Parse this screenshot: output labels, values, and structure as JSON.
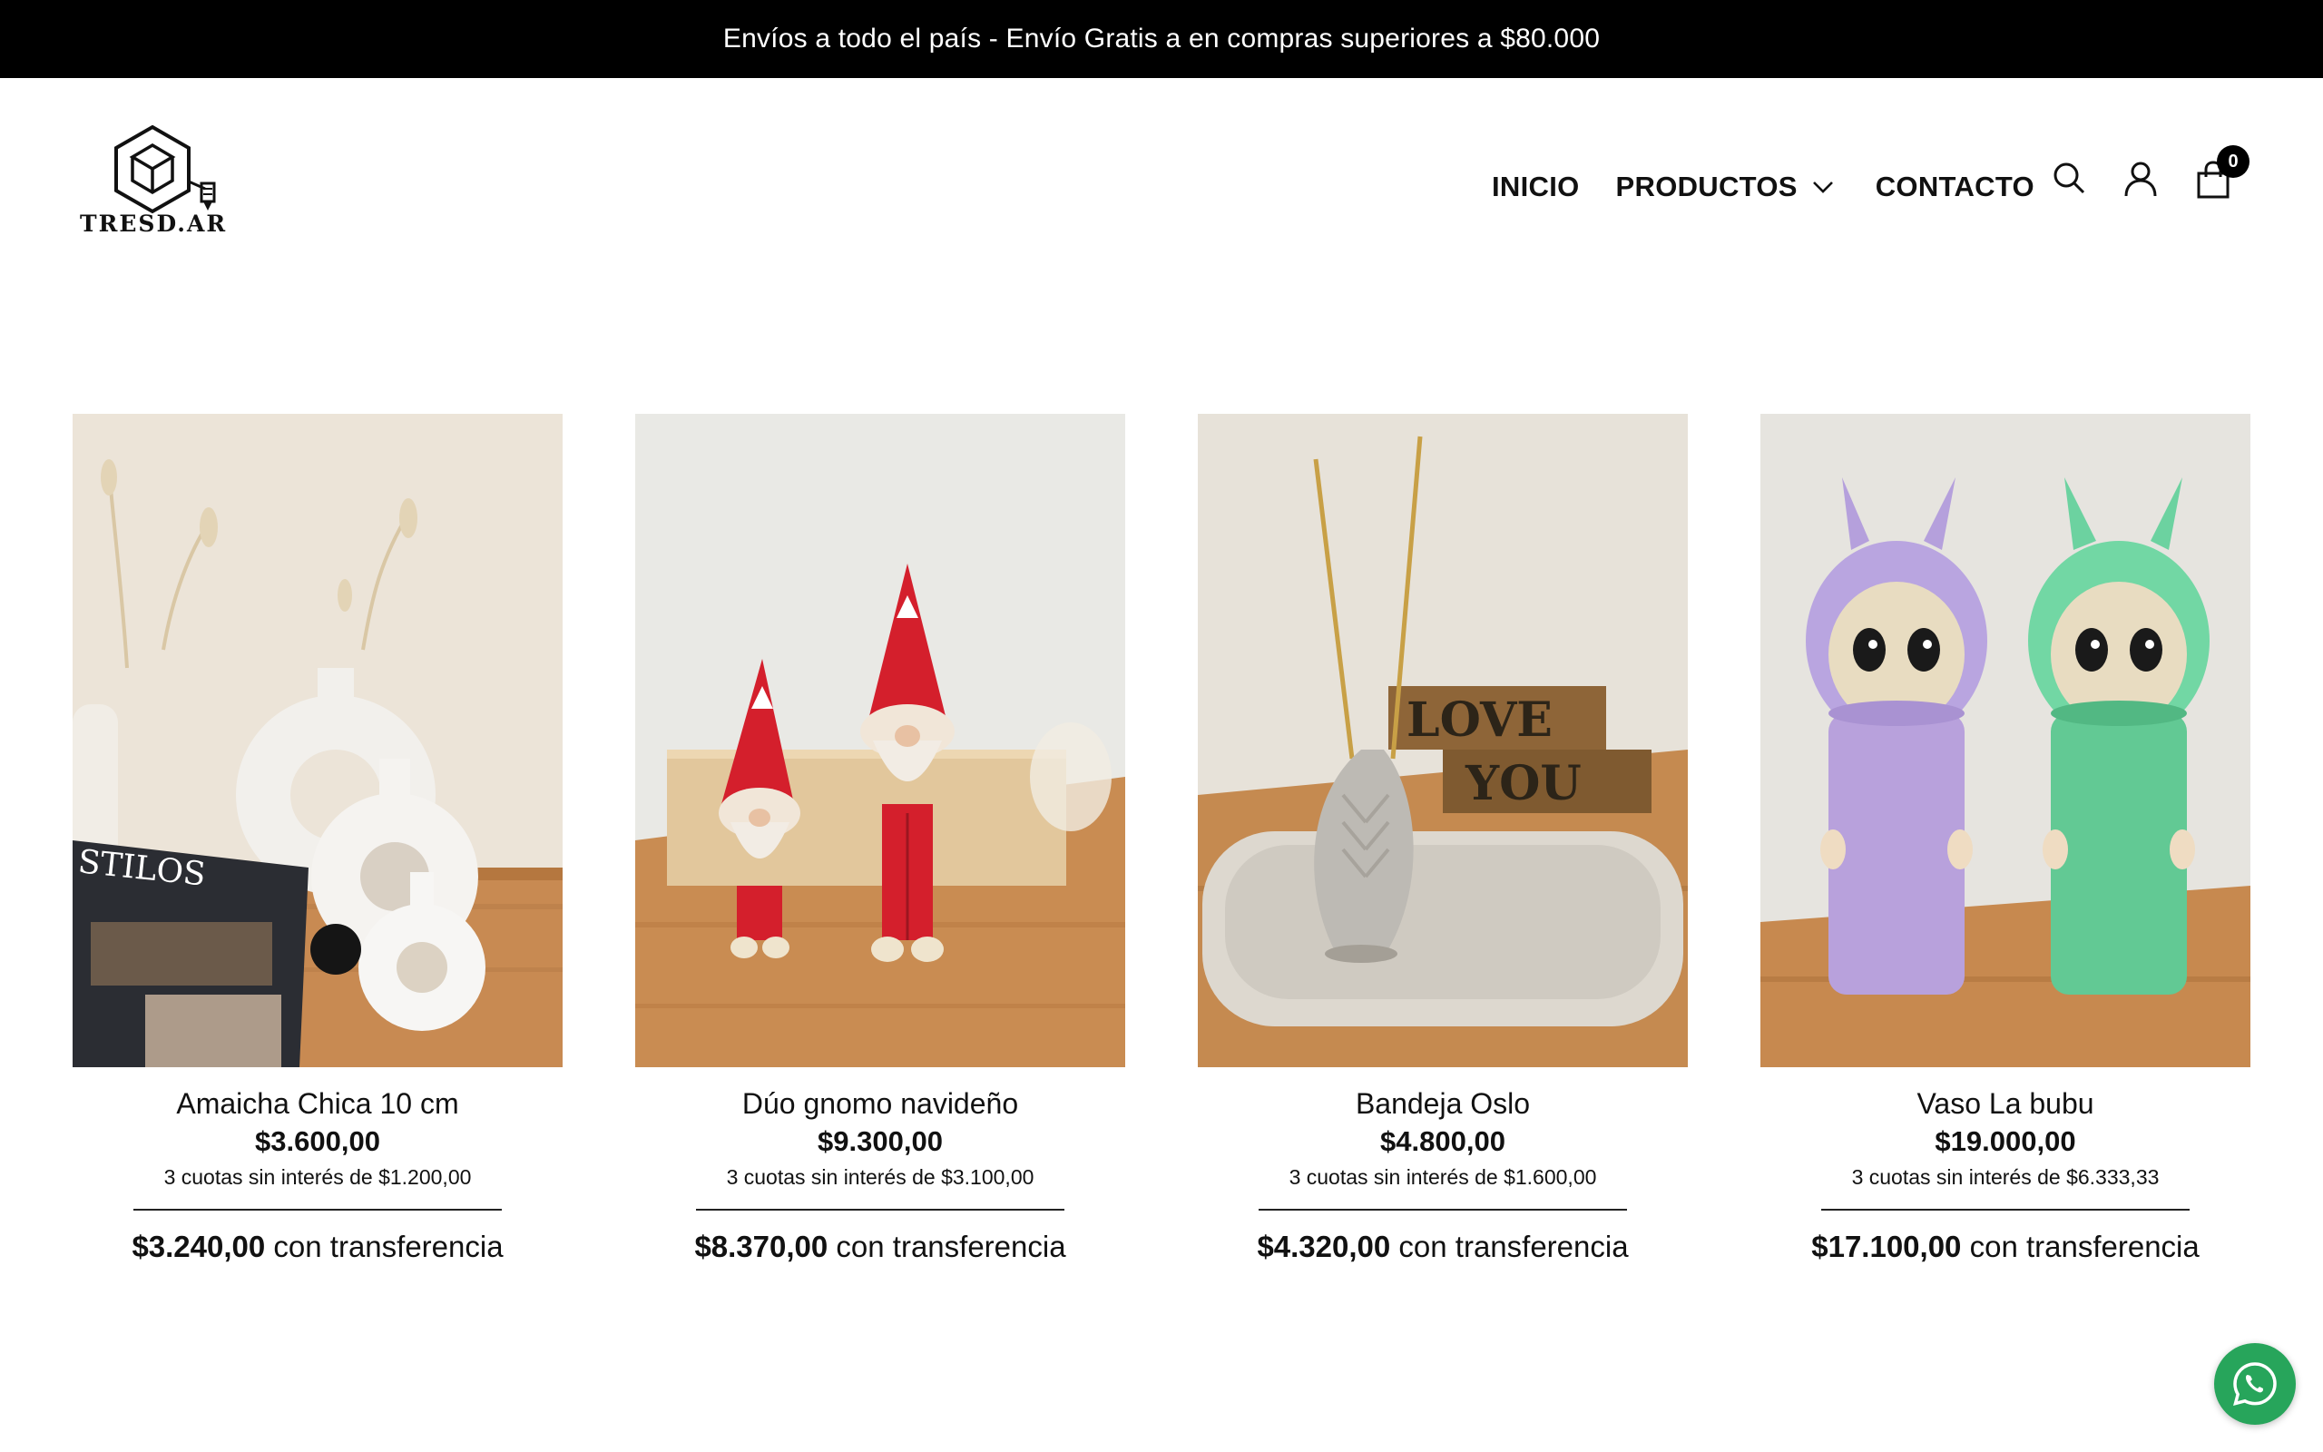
{
  "announcement": "Envíos a todo el país - Envío Gratis a en compras superiores a $80.000",
  "brand": {
    "logo_text": "TRESD.AR"
  },
  "nav": {
    "inicio": "INICIO",
    "productos": "PRODUCTOS",
    "contacto": "CONTACTO",
    "icons": [
      "search-icon",
      "user-icon",
      "shopping-bag-icon"
    ]
  },
  "cart": {
    "count": "0"
  },
  "products": [
    {
      "name": "Amaicha Chica 10 cm",
      "price": "$3.600,00",
      "installments": "3 cuotas sin interés de $1.200,00",
      "transfer_price": "$3.240,00",
      "transfer_suffix": "con transferencia"
    },
    {
      "name": "Dúo gnomo navideño",
      "price": "$9.300,00",
      "installments": "3 cuotas sin interés de $3.100,00",
      "transfer_price": "$8.370,00",
      "transfer_suffix": "con transferencia"
    },
    {
      "name": "Bandeja Oslo",
      "price": "$4.800,00",
      "installments": "3 cuotas sin interés de $1.600,00",
      "transfer_price": "$4.320,00",
      "transfer_suffix": "con transferencia"
    },
    {
      "name": "Vaso La bubu",
      "price": "$19.000,00",
      "installments": "3 cuotas sin interés de $6.333,33",
      "transfer_price": "$17.100,00",
      "transfer_suffix": "con transferencia"
    }
  ],
  "magazine_text": "STILOS",
  "sign_text": [
    "LOVE",
    "YOU"
  ],
  "colors": {
    "announce_bg": "#000000",
    "whatsapp": "#27a55b"
  }
}
